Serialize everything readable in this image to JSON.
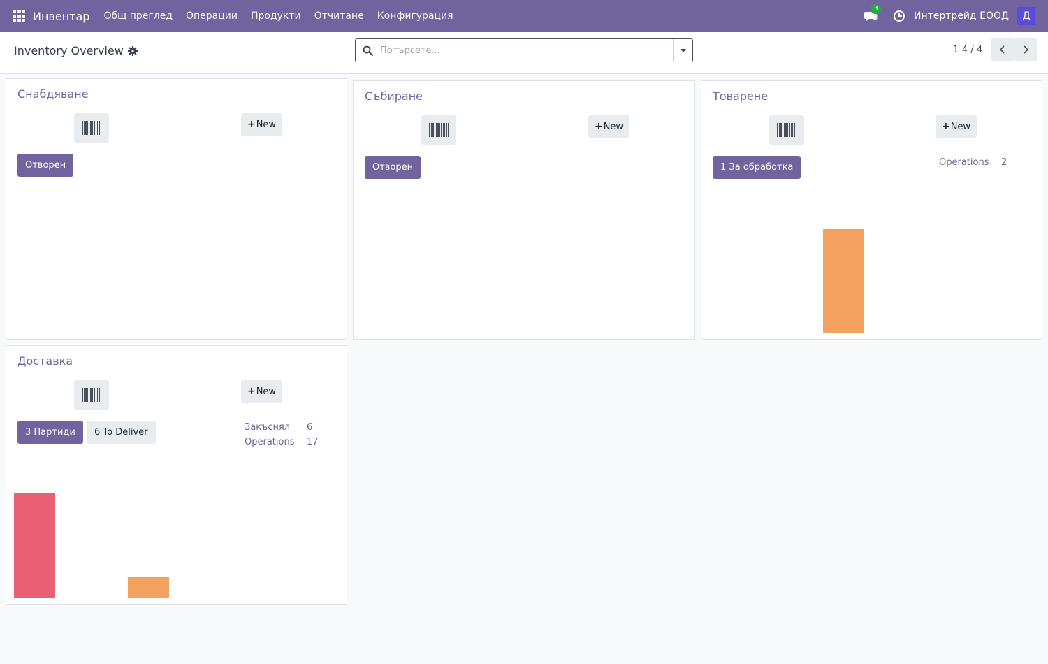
{
  "navbar": {
    "brand": "Инвентар",
    "menu": [
      "Общ преглед",
      "Операции",
      "Продукти",
      "Отчитане",
      "Конфигурация"
    ],
    "messages_count": "3",
    "company": "Интертрейд ЕООД",
    "avatar_initial": "Д"
  },
  "control_panel": {
    "title": "Inventory Overview",
    "search_placeholder": "Потърсете...",
    "pager": "1-4 / 4"
  },
  "cards": [
    {
      "title": "Снабдяване",
      "new_label": "New",
      "primary_label": "Отворен"
    },
    {
      "title": "Събиране",
      "new_label": "New",
      "primary_label": "Отворен"
    },
    {
      "title": "Товарене",
      "new_label": "New",
      "primary_label": "1 За обработка",
      "stats": [
        {
          "label": "Operations",
          "value": "2"
        }
      ],
      "bars": [
        {
          "color": "#f2a15f",
          "value": 1
        }
      ]
    },
    {
      "title": "Доставка",
      "new_label": "New",
      "primary_label": "3 Партиди",
      "secondary_label": "6 To Deliver",
      "stats": [
        {
          "label": "Закъснял",
          "value": "6"
        },
        {
          "label": "Operations",
          "value": "17"
        }
      ],
      "bars": [
        {
          "color": "#ea5f74",
          "value": 5
        },
        {
          "color": "#f2a15f",
          "value": 1
        }
      ]
    }
  ],
  "colors": {
    "brand": "#71639e",
    "late": "#ea5f74",
    "ready": "#f2a15f"
  }
}
